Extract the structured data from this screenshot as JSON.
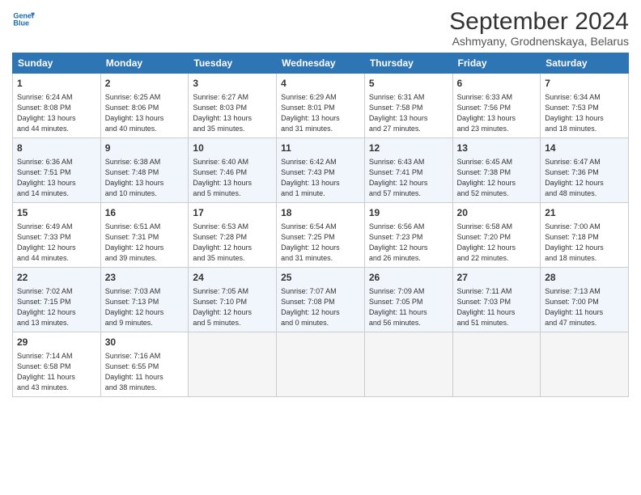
{
  "logo": {
    "line1": "General",
    "line2": "Blue"
  },
  "title": "September 2024",
  "subtitle": "Ashmyany, Grodnenskaya, Belarus",
  "headers": [
    "Sunday",
    "Monday",
    "Tuesday",
    "Wednesday",
    "Thursday",
    "Friday",
    "Saturday"
  ],
  "weeks": [
    [
      {
        "day": "1",
        "info": "Sunrise: 6:24 AM\nSunset: 8:08 PM\nDaylight: 13 hours\nand 44 minutes."
      },
      {
        "day": "2",
        "info": "Sunrise: 6:25 AM\nSunset: 8:06 PM\nDaylight: 13 hours\nand 40 minutes."
      },
      {
        "day": "3",
        "info": "Sunrise: 6:27 AM\nSunset: 8:03 PM\nDaylight: 13 hours\nand 35 minutes."
      },
      {
        "day": "4",
        "info": "Sunrise: 6:29 AM\nSunset: 8:01 PM\nDaylight: 13 hours\nand 31 minutes."
      },
      {
        "day": "5",
        "info": "Sunrise: 6:31 AM\nSunset: 7:58 PM\nDaylight: 13 hours\nand 27 minutes."
      },
      {
        "day": "6",
        "info": "Sunrise: 6:33 AM\nSunset: 7:56 PM\nDaylight: 13 hours\nand 23 minutes."
      },
      {
        "day": "7",
        "info": "Sunrise: 6:34 AM\nSunset: 7:53 PM\nDaylight: 13 hours\nand 18 minutes."
      }
    ],
    [
      {
        "day": "8",
        "info": "Sunrise: 6:36 AM\nSunset: 7:51 PM\nDaylight: 13 hours\nand 14 minutes."
      },
      {
        "day": "9",
        "info": "Sunrise: 6:38 AM\nSunset: 7:48 PM\nDaylight: 13 hours\nand 10 minutes."
      },
      {
        "day": "10",
        "info": "Sunrise: 6:40 AM\nSunset: 7:46 PM\nDaylight: 13 hours\nand 5 minutes."
      },
      {
        "day": "11",
        "info": "Sunrise: 6:42 AM\nSunset: 7:43 PM\nDaylight: 13 hours\nand 1 minute."
      },
      {
        "day": "12",
        "info": "Sunrise: 6:43 AM\nSunset: 7:41 PM\nDaylight: 12 hours\nand 57 minutes."
      },
      {
        "day": "13",
        "info": "Sunrise: 6:45 AM\nSunset: 7:38 PM\nDaylight: 12 hours\nand 52 minutes."
      },
      {
        "day": "14",
        "info": "Sunrise: 6:47 AM\nSunset: 7:36 PM\nDaylight: 12 hours\nand 48 minutes."
      }
    ],
    [
      {
        "day": "15",
        "info": "Sunrise: 6:49 AM\nSunset: 7:33 PM\nDaylight: 12 hours\nand 44 minutes."
      },
      {
        "day": "16",
        "info": "Sunrise: 6:51 AM\nSunset: 7:31 PM\nDaylight: 12 hours\nand 39 minutes."
      },
      {
        "day": "17",
        "info": "Sunrise: 6:53 AM\nSunset: 7:28 PM\nDaylight: 12 hours\nand 35 minutes."
      },
      {
        "day": "18",
        "info": "Sunrise: 6:54 AM\nSunset: 7:25 PM\nDaylight: 12 hours\nand 31 minutes."
      },
      {
        "day": "19",
        "info": "Sunrise: 6:56 AM\nSunset: 7:23 PM\nDaylight: 12 hours\nand 26 minutes."
      },
      {
        "day": "20",
        "info": "Sunrise: 6:58 AM\nSunset: 7:20 PM\nDaylight: 12 hours\nand 22 minutes."
      },
      {
        "day": "21",
        "info": "Sunrise: 7:00 AM\nSunset: 7:18 PM\nDaylight: 12 hours\nand 18 minutes."
      }
    ],
    [
      {
        "day": "22",
        "info": "Sunrise: 7:02 AM\nSunset: 7:15 PM\nDaylight: 12 hours\nand 13 minutes."
      },
      {
        "day": "23",
        "info": "Sunrise: 7:03 AM\nSunset: 7:13 PM\nDaylight: 12 hours\nand 9 minutes."
      },
      {
        "day": "24",
        "info": "Sunrise: 7:05 AM\nSunset: 7:10 PM\nDaylight: 12 hours\nand 5 minutes."
      },
      {
        "day": "25",
        "info": "Sunrise: 7:07 AM\nSunset: 7:08 PM\nDaylight: 12 hours\nand 0 minutes."
      },
      {
        "day": "26",
        "info": "Sunrise: 7:09 AM\nSunset: 7:05 PM\nDaylight: 11 hours\nand 56 minutes."
      },
      {
        "day": "27",
        "info": "Sunrise: 7:11 AM\nSunset: 7:03 PM\nDaylight: 11 hours\nand 51 minutes."
      },
      {
        "day": "28",
        "info": "Sunrise: 7:13 AM\nSunset: 7:00 PM\nDaylight: 11 hours\nand 47 minutes."
      }
    ],
    [
      {
        "day": "29",
        "info": "Sunrise: 7:14 AM\nSunset: 6:58 PM\nDaylight: 11 hours\nand 43 minutes."
      },
      {
        "day": "30",
        "info": "Sunrise: 7:16 AM\nSunset: 6:55 PM\nDaylight: 11 hours\nand 38 minutes."
      },
      {
        "day": "",
        "info": ""
      },
      {
        "day": "",
        "info": ""
      },
      {
        "day": "",
        "info": ""
      },
      {
        "day": "",
        "info": ""
      },
      {
        "day": "",
        "info": ""
      }
    ]
  ]
}
